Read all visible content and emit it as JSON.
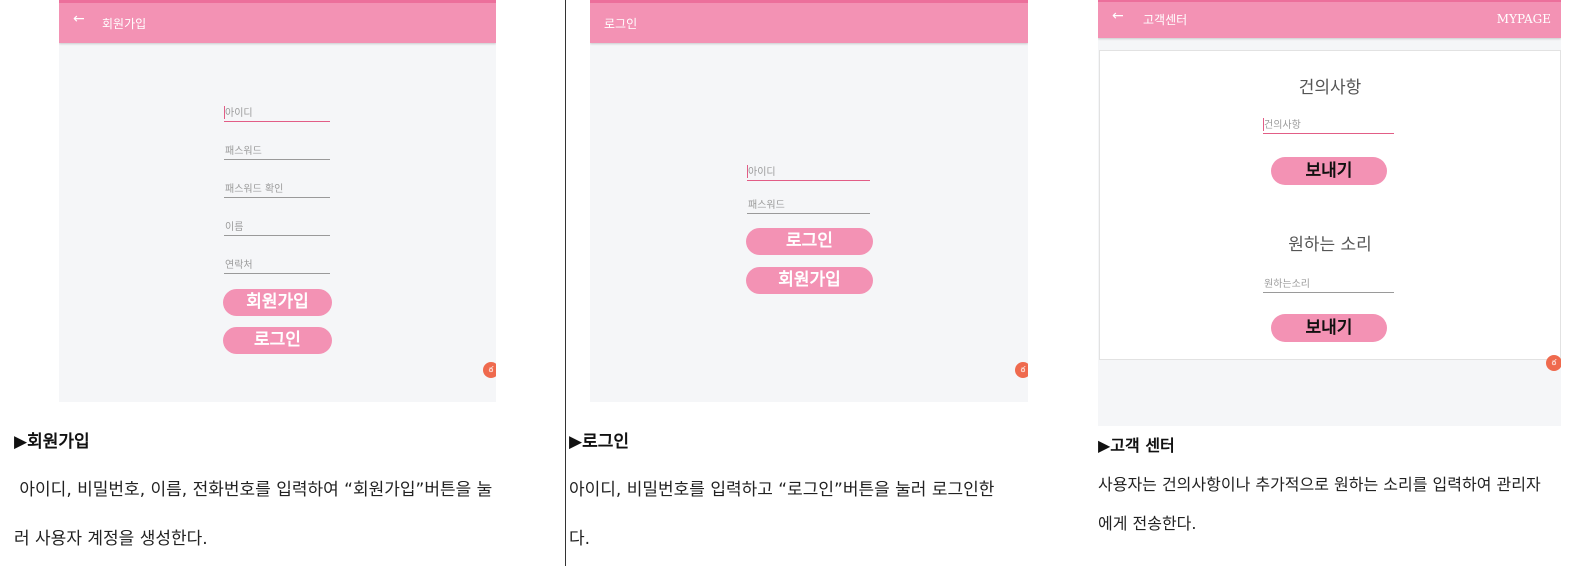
{
  "signup_screen": {
    "title": "회원가입",
    "back_icon": "←",
    "fields": [
      "아이디",
      "패스워드",
      "패스워드 확인",
      "이름",
      "연락처"
    ],
    "signup_button": "회원가입",
    "login_button": "로그인",
    "fab_label": "ఠ"
  },
  "login_screen": {
    "title": "로그인",
    "fields": [
      "아이디",
      "패스워드"
    ],
    "login_button": "로그인",
    "signup_button": "회원가입",
    "fab_label": "ఠ"
  },
  "support_screen": {
    "title": "고객센터",
    "back_icon": "←",
    "mypage_label": "MYPAGE",
    "suggestion_title": "건의사항",
    "suggestion_placeholder": "건의사항",
    "send_label_1": "보내기",
    "wish_title": "원하는 소리",
    "wish_placeholder": "원하는소리",
    "send_label_2": "보내기",
    "fab_label": "ఠ"
  },
  "captions": {
    "signup": {
      "heading": "▶회원가입",
      "line1": " 아이디, 비밀번호, 이름, 전화번호를 입력하여 “회원가입”버튼을 눌",
      "line2": "러 사용자 계정을 생성한다."
    },
    "login": {
      "heading": "▶로그인",
      "line1": "아이디, 비밀번호를 입력하고 “로그인”버튼을 눌러 로그인한",
      "line2": "다."
    },
    "support": {
      "heading": "▶고객 센터",
      "line1": "사용자는 건의사항이나 추가적으로 원하는 소리를 입력하여 관리자",
      "line2": "에게 전송한다."
    }
  },
  "colors": {
    "accent": "#f392b4",
    "appbar_border": "#ec6f9b",
    "screen_bg": "#f5f6f8",
    "fab": "#ef6a4e"
  }
}
